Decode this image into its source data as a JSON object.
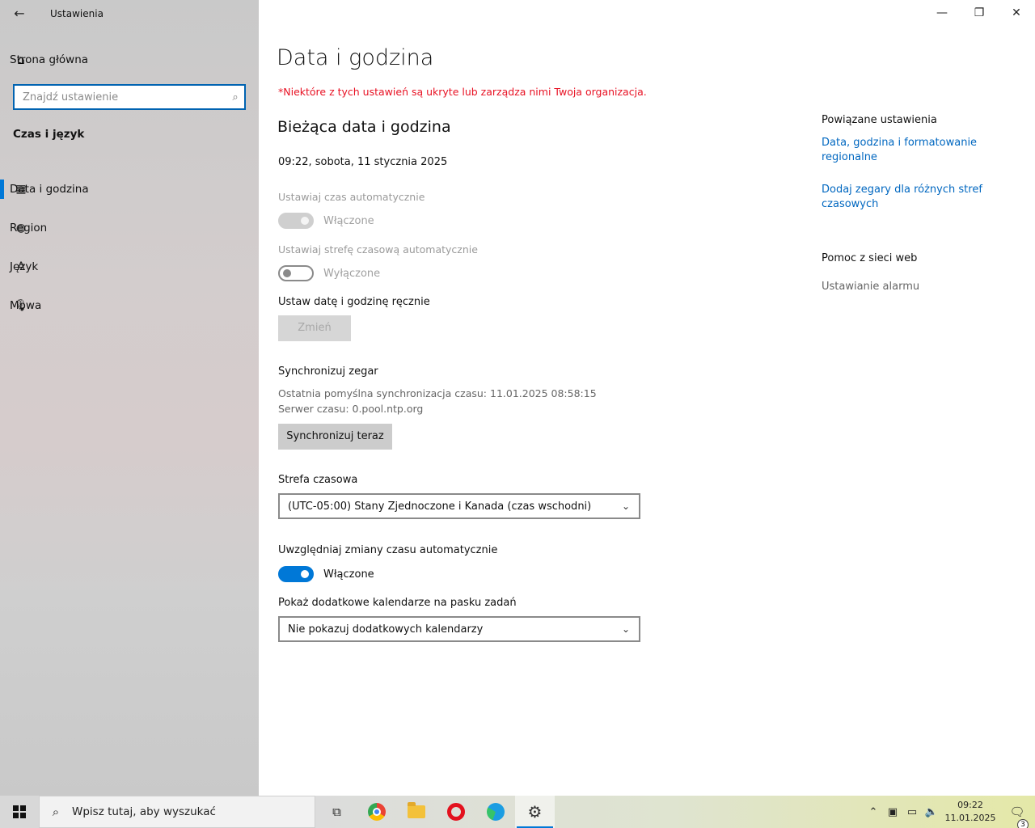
{
  "app": {
    "title": "Ustawienia",
    "back_icon": "back-arrow-icon"
  },
  "sidebar": {
    "home_label": "Strona główna",
    "search_placeholder": "Znajdź ustawienie",
    "section_title": "Czas i język",
    "items": [
      {
        "label": "Data i godzina",
        "icon": "calendar-clock-icon",
        "selected": true
      },
      {
        "label": "Region",
        "icon": "globe-icon",
        "selected": false
      },
      {
        "label": "Język",
        "icon": "language-icon",
        "selected": false
      },
      {
        "label": "Mowa",
        "icon": "microphone-icon",
        "selected": false
      }
    ]
  },
  "main": {
    "page_title": "Data i godzina",
    "org_note": "*Niektóre z tych ustawień są ukryte lub zarządza nimi Twoja organizacja.",
    "section_title": "Bieżąca data i godzina",
    "current_datetime": "09:22, sobota, 11 stycznia 2025",
    "auto_time": {
      "label": "Ustawiaj czas automatycznie",
      "state": "Włączone",
      "on": true,
      "disabled": true
    },
    "auto_timezone": {
      "label": "Ustawiaj strefę czasową automatycznie",
      "state": "Wyłączone",
      "on": false,
      "disabled": true
    },
    "manual": {
      "label": "Ustaw datę i godzinę ręcznie",
      "button": "Zmień"
    },
    "sync": {
      "title": "Synchronizuj zegar",
      "last_sync": "Ostatnia pomyślna synchronizacja czasu: 11.01.2025 08:58:15",
      "server": "Serwer czasu: 0.pool.ntp.org",
      "button": "Synchronizuj teraz"
    },
    "timezone": {
      "label": "Strefa czasowa",
      "value": "(UTC-05:00) Stany Zjednoczone i Kanada (czas wschodni)"
    },
    "dst": {
      "label": "Uwzględniaj zmiany czasu automatycznie",
      "state": "Włączone",
      "on": true
    },
    "calendars": {
      "label": "Pokaż dodatkowe kalendarze na pasku zadań",
      "value": "Nie pokazuj dodatkowych kalendarzy"
    }
  },
  "related": {
    "title": "Powiązane ustawienia",
    "links": [
      "Data, godzina i formatowanie regionalne",
      "Dodaj zegary dla różnych stref czasowych"
    ],
    "help_title": "Pomoc z sieci web",
    "help_link": "Ustawianie alarmu"
  },
  "taskbar": {
    "search_placeholder": "Wpisz tutaj, aby wyszukać",
    "time": "09:22",
    "date": "11.01.2025",
    "notification_count": "3",
    "accent": "#0078d7"
  }
}
